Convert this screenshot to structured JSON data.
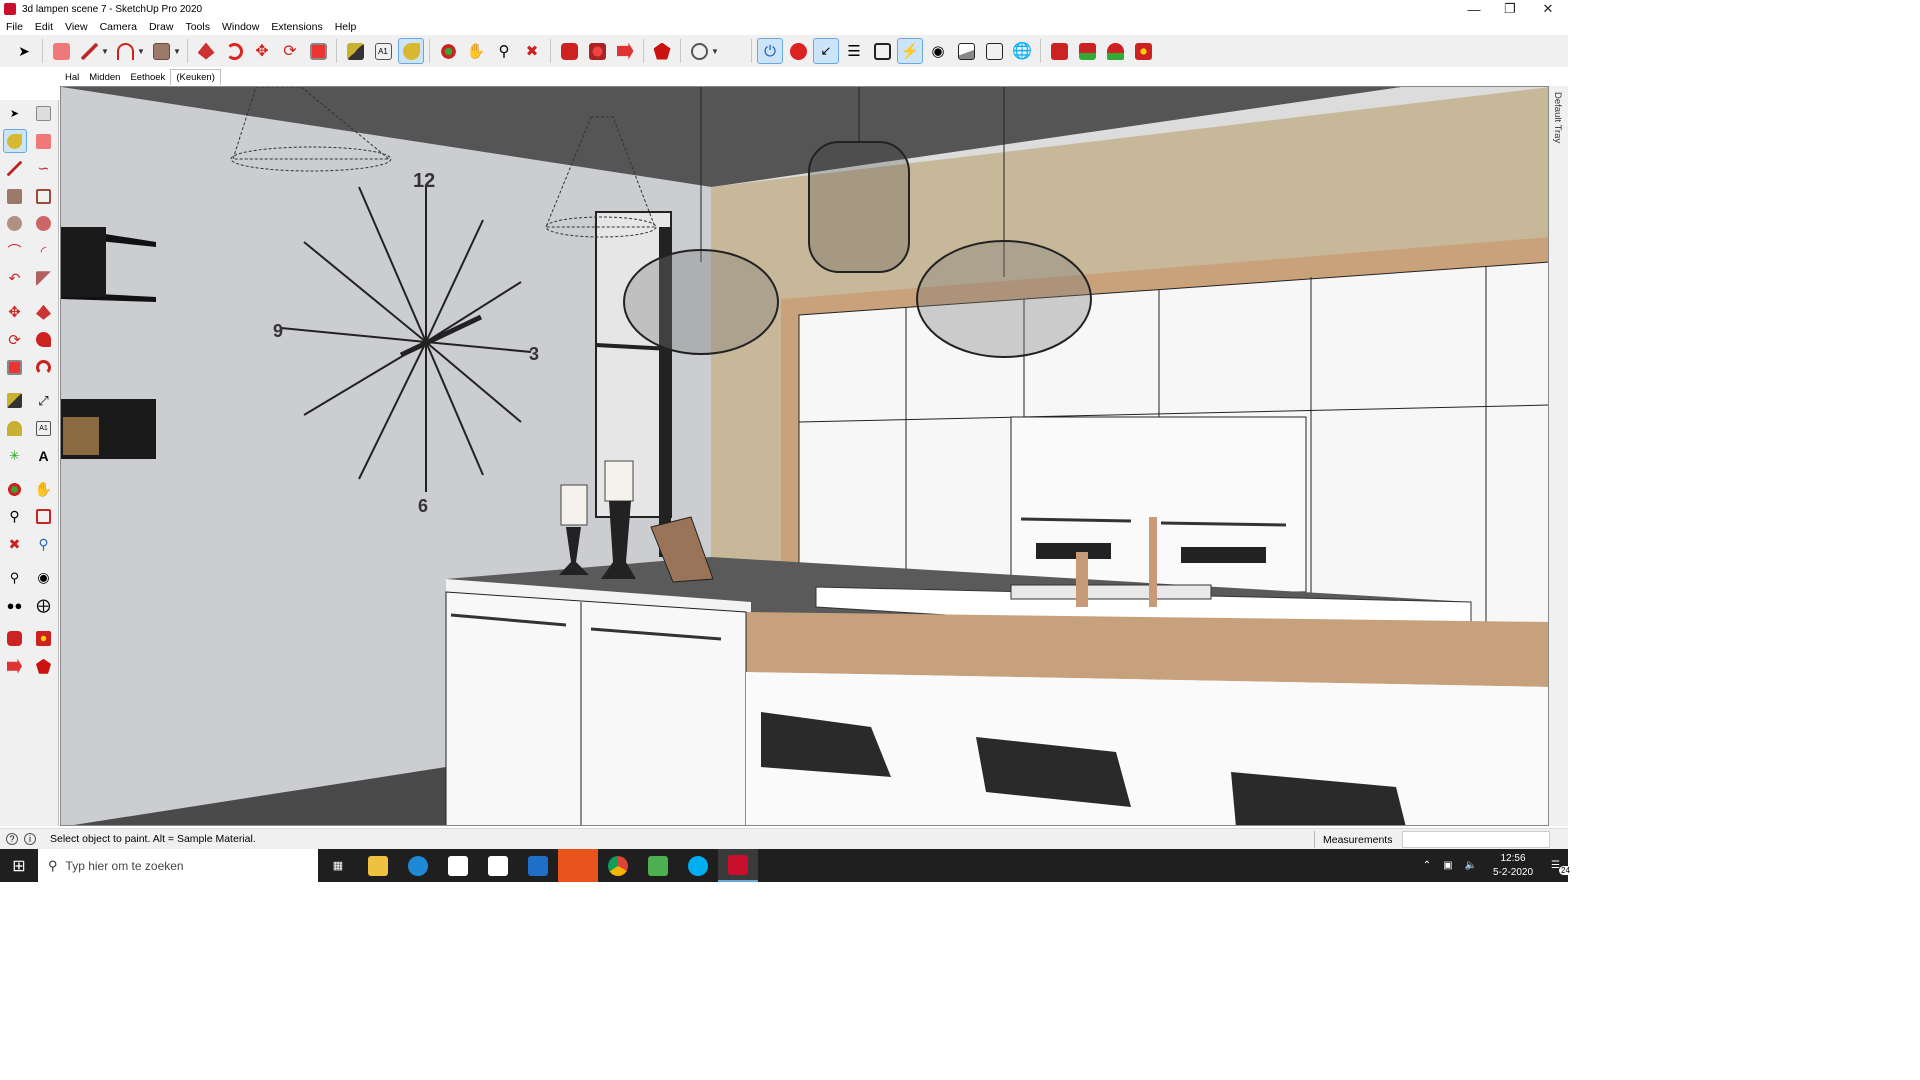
{
  "window": {
    "title": "3d lampen scene 7 - SketchUp Pro 2020"
  },
  "menu": [
    "File",
    "Edit",
    "View",
    "Camera",
    "Draw",
    "Tools",
    "Window",
    "Extensions",
    "Help"
  ],
  "scenes": [
    {
      "label": "Hal",
      "current": false
    },
    {
      "label": "Midden",
      "current": false
    },
    {
      "label": "Eethoek",
      "current": false
    },
    {
      "label": "(Keuken)",
      "current": true
    }
  ],
  "tray": {
    "label": "Default Tray"
  },
  "clock_face": {
    "n12": "12",
    "n3": "3",
    "n6": "6",
    "n9": "9"
  },
  "status": {
    "text": "Select object to paint. Alt = Sample Material.",
    "measurements_label": "Measurements",
    "measurements_value": ""
  },
  "taskbar": {
    "search_placeholder": "Typ hier om te zoeken",
    "time": "12:56",
    "date": "5-2-2020",
    "notif_count": "24"
  },
  "colors": {
    "accent": "#c8102e",
    "active_bg": "#cce4f7",
    "taskbar": "#1f1f1f"
  }
}
